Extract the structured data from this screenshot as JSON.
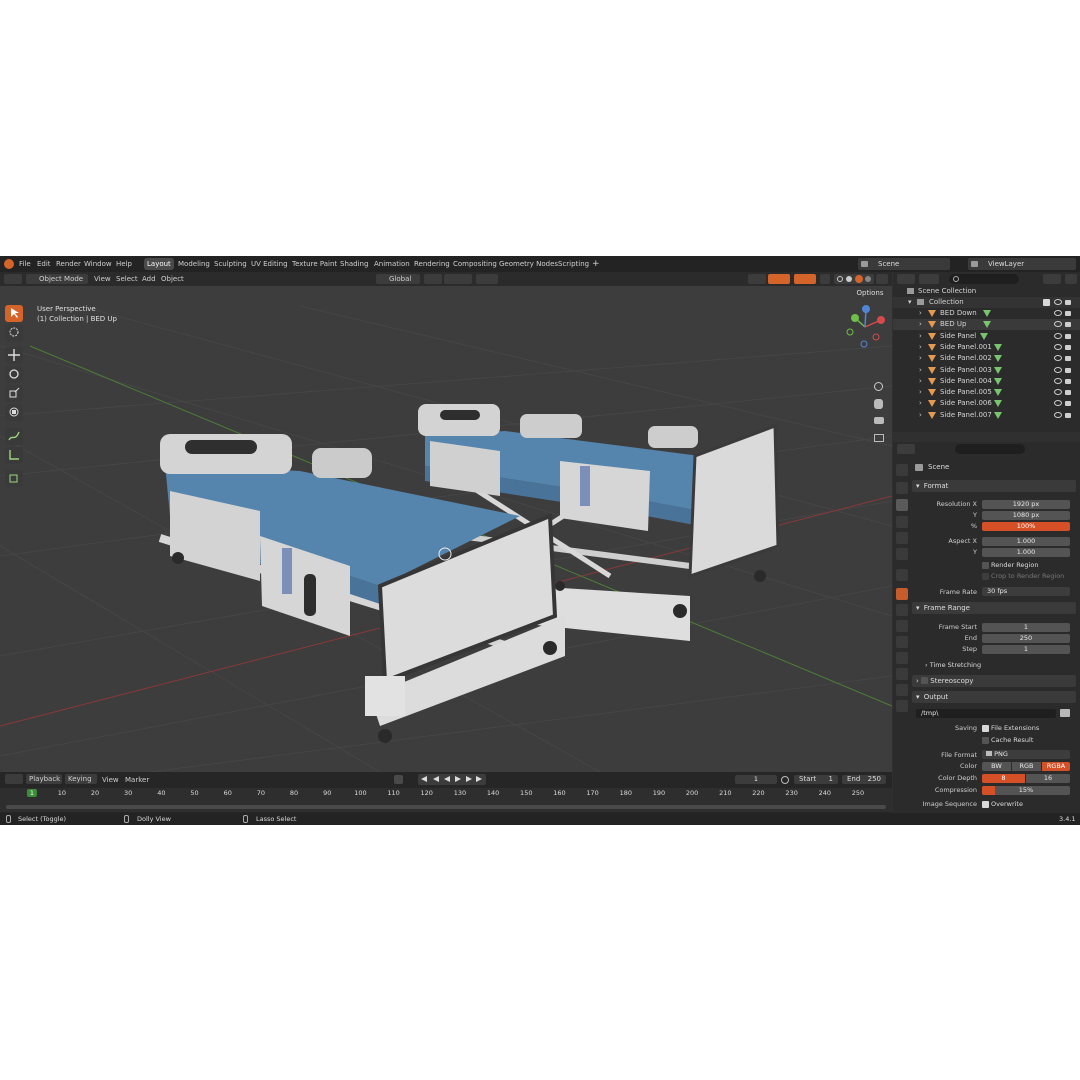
{
  "menu": {
    "items": [
      "File",
      "Edit",
      "Render",
      "Window",
      "Help"
    ]
  },
  "workspaces": {
    "tabs": [
      "Layout",
      "Modeling",
      "Sculpting",
      "UV Editing",
      "Texture Paint",
      "Shading",
      "Animation",
      "Rendering",
      "Compositing",
      "Geometry Nodes",
      "Scripting"
    ],
    "add": "+"
  },
  "scene": {
    "name": "Scene",
    "view_layer": "ViewLayer"
  },
  "viewport_header": {
    "mode": "Object Mode",
    "menus": [
      "View",
      "Select",
      "Add",
      "Object"
    ],
    "orientation": "Global",
    "options": "Options"
  },
  "viewport": {
    "view_name": "User Perspective",
    "collection_info": "(1) Collection | BED Up"
  },
  "outliner": {
    "root": "Scene Collection",
    "collection": "Collection",
    "items": [
      "BED Down",
      "BED Up",
      "Side Panel",
      "Side Panel.001",
      "Side Panel.002",
      "Side Panel.003",
      "Side Panel.004",
      "Side Panel.005",
      "Side Panel.006",
      "Side Panel.007"
    ]
  },
  "properties": {
    "context": "Scene",
    "format": {
      "title": "Format",
      "resolution_x_label": "Resolution X",
      "resolution_x": "1920 px",
      "y_label": "Y",
      "resolution_y": "1080 px",
      "percent_label": "%",
      "percent": "100%",
      "aspect_x_label": "Aspect X",
      "aspect_x": "1.000",
      "aspect_y_label": "Y",
      "aspect_y": "1.000",
      "render_region": "Render Region",
      "crop": "Crop to Render Region",
      "frame_rate_label": "Frame Rate",
      "frame_rate": "30 fps"
    },
    "frame_range": {
      "title": "Frame Range",
      "start_label": "Frame Start",
      "start": "1",
      "end_label": "End",
      "end": "250",
      "step_label": "Step",
      "step": "1"
    },
    "time_stretching": "Time Stretching",
    "stereoscopy": "Stereoscopy",
    "output": {
      "title": "Output",
      "path": "/tmp\\",
      "saving_label": "Saving",
      "file_extensions": "File Extensions",
      "cache_result": "Cache Result",
      "file_format_label": "File Format",
      "file_format": "PNG",
      "color_label": "Color",
      "color_options": [
        "BW",
        "RGB",
        "RGBA"
      ],
      "color_selected": "RGBA",
      "color_depth_label": "Color Depth",
      "color_depth_options": [
        "8",
        "16"
      ],
      "color_depth_selected": "8",
      "compression_label": "Compression",
      "compression": "15%",
      "compression_fraction": 0.15,
      "image_sequence_label": "Image Sequence",
      "overwrite": "Overwrite"
    }
  },
  "timeline": {
    "menus": [
      "Playback",
      "Keying",
      "View",
      "Marker"
    ],
    "current_frame": "1",
    "start_label": "Start",
    "start": "1",
    "end_label": "End",
    "end": "250",
    "ticks": [
      "1",
      "10",
      "20",
      "30",
      "40",
      "50",
      "60",
      "70",
      "80",
      "90",
      "100",
      "110",
      "120",
      "130",
      "140",
      "150",
      "160",
      "170",
      "180",
      "190",
      "200",
      "210",
      "220",
      "230",
      "240",
      "250"
    ]
  },
  "statusbar": {
    "select": "Select (Toggle)",
    "dolly": "Dolly View",
    "lasso": "Lasso Select",
    "version": "3.4.1"
  },
  "colors": {
    "accent": "#d5642a",
    "viewport_bg": "#3d3d3d",
    "panel_bg": "#2b2b2b",
    "header_bg": "#232323",
    "mattress": "#4f7ea6"
  }
}
